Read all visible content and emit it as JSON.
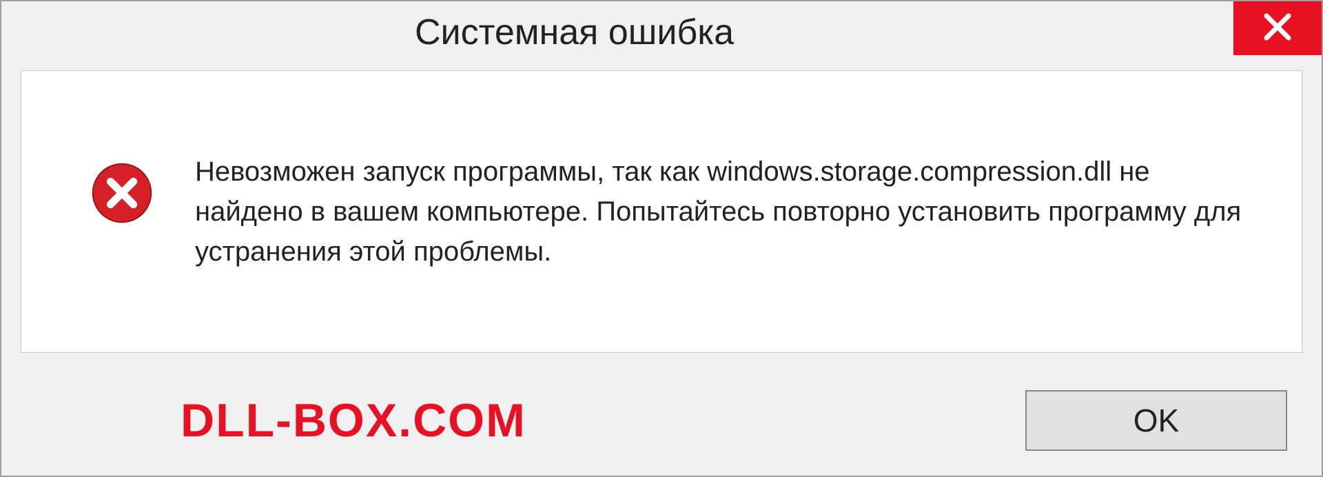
{
  "dialog": {
    "title": "Системная ошибка",
    "message": "Невозможен запуск программы, так как windows.storage.compression.dll не найдено в вашем компьютере. Попытайтесь повторно установить программу для устранения этой проблемы.",
    "ok_label": "OK"
  },
  "watermark": "DLL-BOX.COM",
  "colors": {
    "accent_red": "#e81123",
    "dialog_bg": "#f0f0f0",
    "content_bg": "#ffffff"
  }
}
